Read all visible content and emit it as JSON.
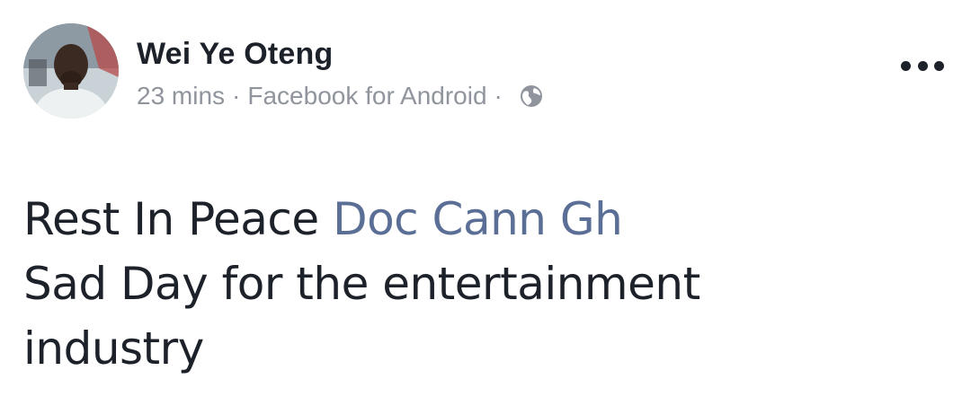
{
  "post": {
    "author": {
      "name": "Wei Ye Oteng"
    },
    "meta": {
      "time": "23 mins",
      "separator": "·",
      "source": "Facebook for Android",
      "privacy_icon": "globe-icon"
    },
    "more_icon": "more-horizontal-icon",
    "body": {
      "line1_text": "Rest In Peace",
      "mention": "Doc Cann Gh",
      "line2": "Sad Day for the entertainment",
      "line3": "industry"
    }
  },
  "colors": {
    "text": "#1d2129",
    "meta": "#90949c",
    "mention": "#5b6f96",
    "background": "#ffffff"
  }
}
